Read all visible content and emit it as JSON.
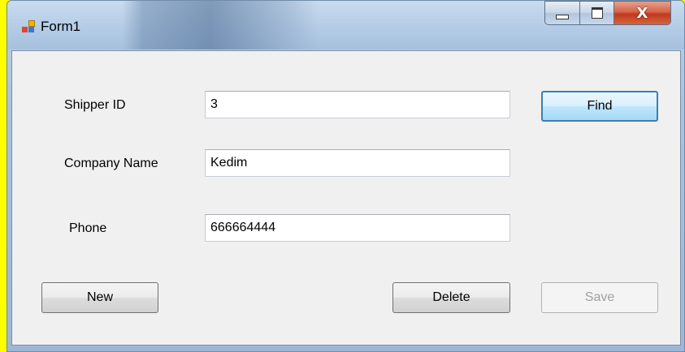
{
  "window": {
    "title": "Form1",
    "caption": {
      "minimize": "minimize-icon",
      "maximize": "maximize-icon",
      "close": "close-icon"
    }
  },
  "form": {
    "shipper_id": {
      "label": "Shipper ID",
      "value": "3"
    },
    "company_name": {
      "label": "Company Name",
      "value": "Kedim"
    },
    "phone": {
      "label": "Phone",
      "value": "666664444"
    }
  },
  "buttons": {
    "find": "Find",
    "new": "New",
    "delete": "Delete",
    "save": "Save"
  },
  "colors": {
    "background_highlight": "#ffff00",
    "default_button_border": "#3c7fb1",
    "close_button": "#c1391d"
  }
}
